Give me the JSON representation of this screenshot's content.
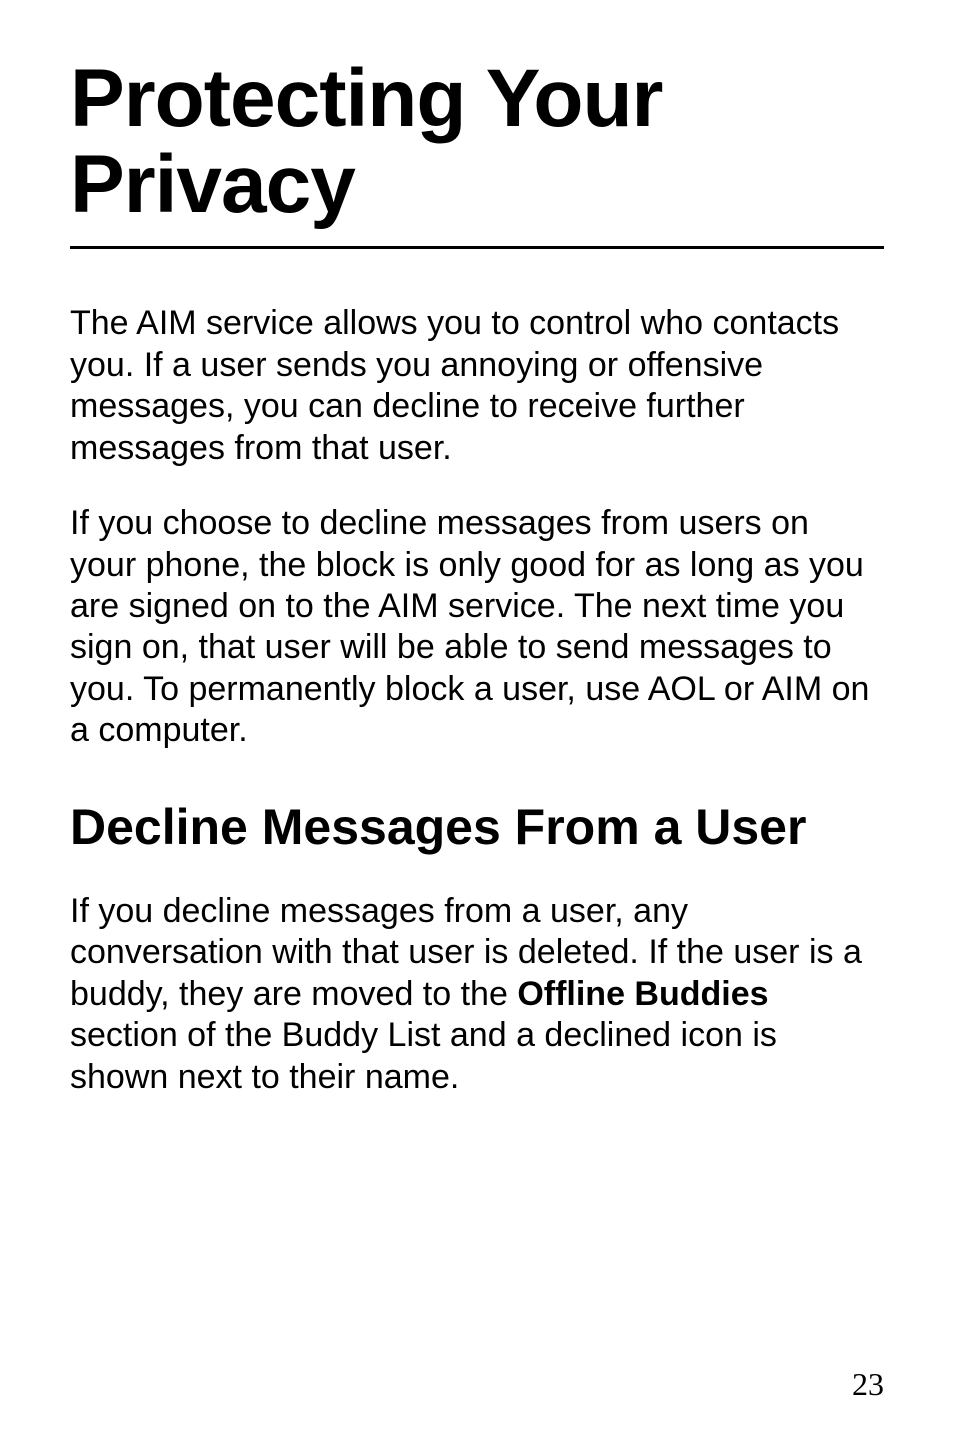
{
  "title": "Protecting Your Privacy",
  "para1": "The AIM service allows you to control who contacts you. If a user sends you annoying or offensive messages, you can decline to receive further messages from that user.",
  "para2": "If you choose to decline messages from users on your phone, the block is only good for as long as you are signed on to the AIM service. The next time you sign on, that user will be able to send messages to you. To permanently block a user, use AOL or AIM on a computer.",
  "subheading": "Decline Messages From a User",
  "para3_part1": "If you decline messages from a user, any conversation with that user is deleted. If the user is a buddy, they are moved to the ",
  "para3_bold": "Offline Buddies",
  "para3_part2": " section of the Buddy List and a declined icon is shown next to their name.",
  "page_number": "23"
}
